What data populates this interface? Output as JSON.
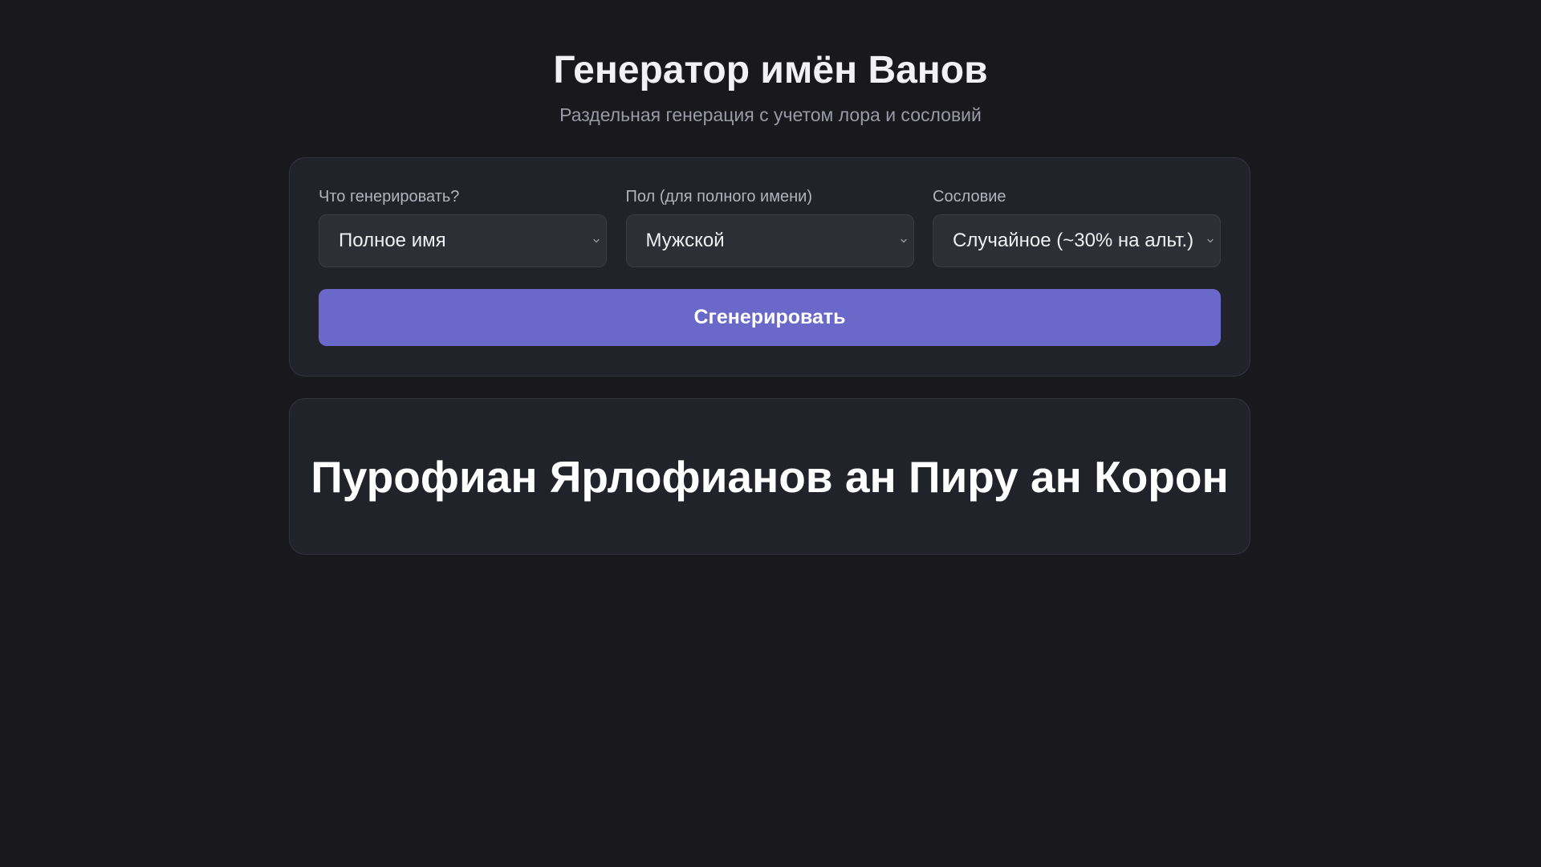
{
  "header": {
    "title": "Генератор имён Ванов",
    "subtitle": "Раздельная генерация с учетом лора и сословий"
  },
  "controls": {
    "fields": [
      {
        "label": "Что генерировать?",
        "value": "Полное имя"
      },
      {
        "label": "Пол (для полного имени)",
        "value": "Мужской"
      },
      {
        "label": "Сословие",
        "value": "Случайное (~30% на альт.)"
      }
    ],
    "generate_label": "Сгенерировать"
  },
  "result": {
    "name": "Пурофиан Ярлофианов ан Пиру ан Корон"
  },
  "colors": {
    "background": "#18181d",
    "card": "#22222a",
    "accent": "#6a68c8"
  },
  "icons": {
    "select_indicator": "chevron-down-icon"
  }
}
